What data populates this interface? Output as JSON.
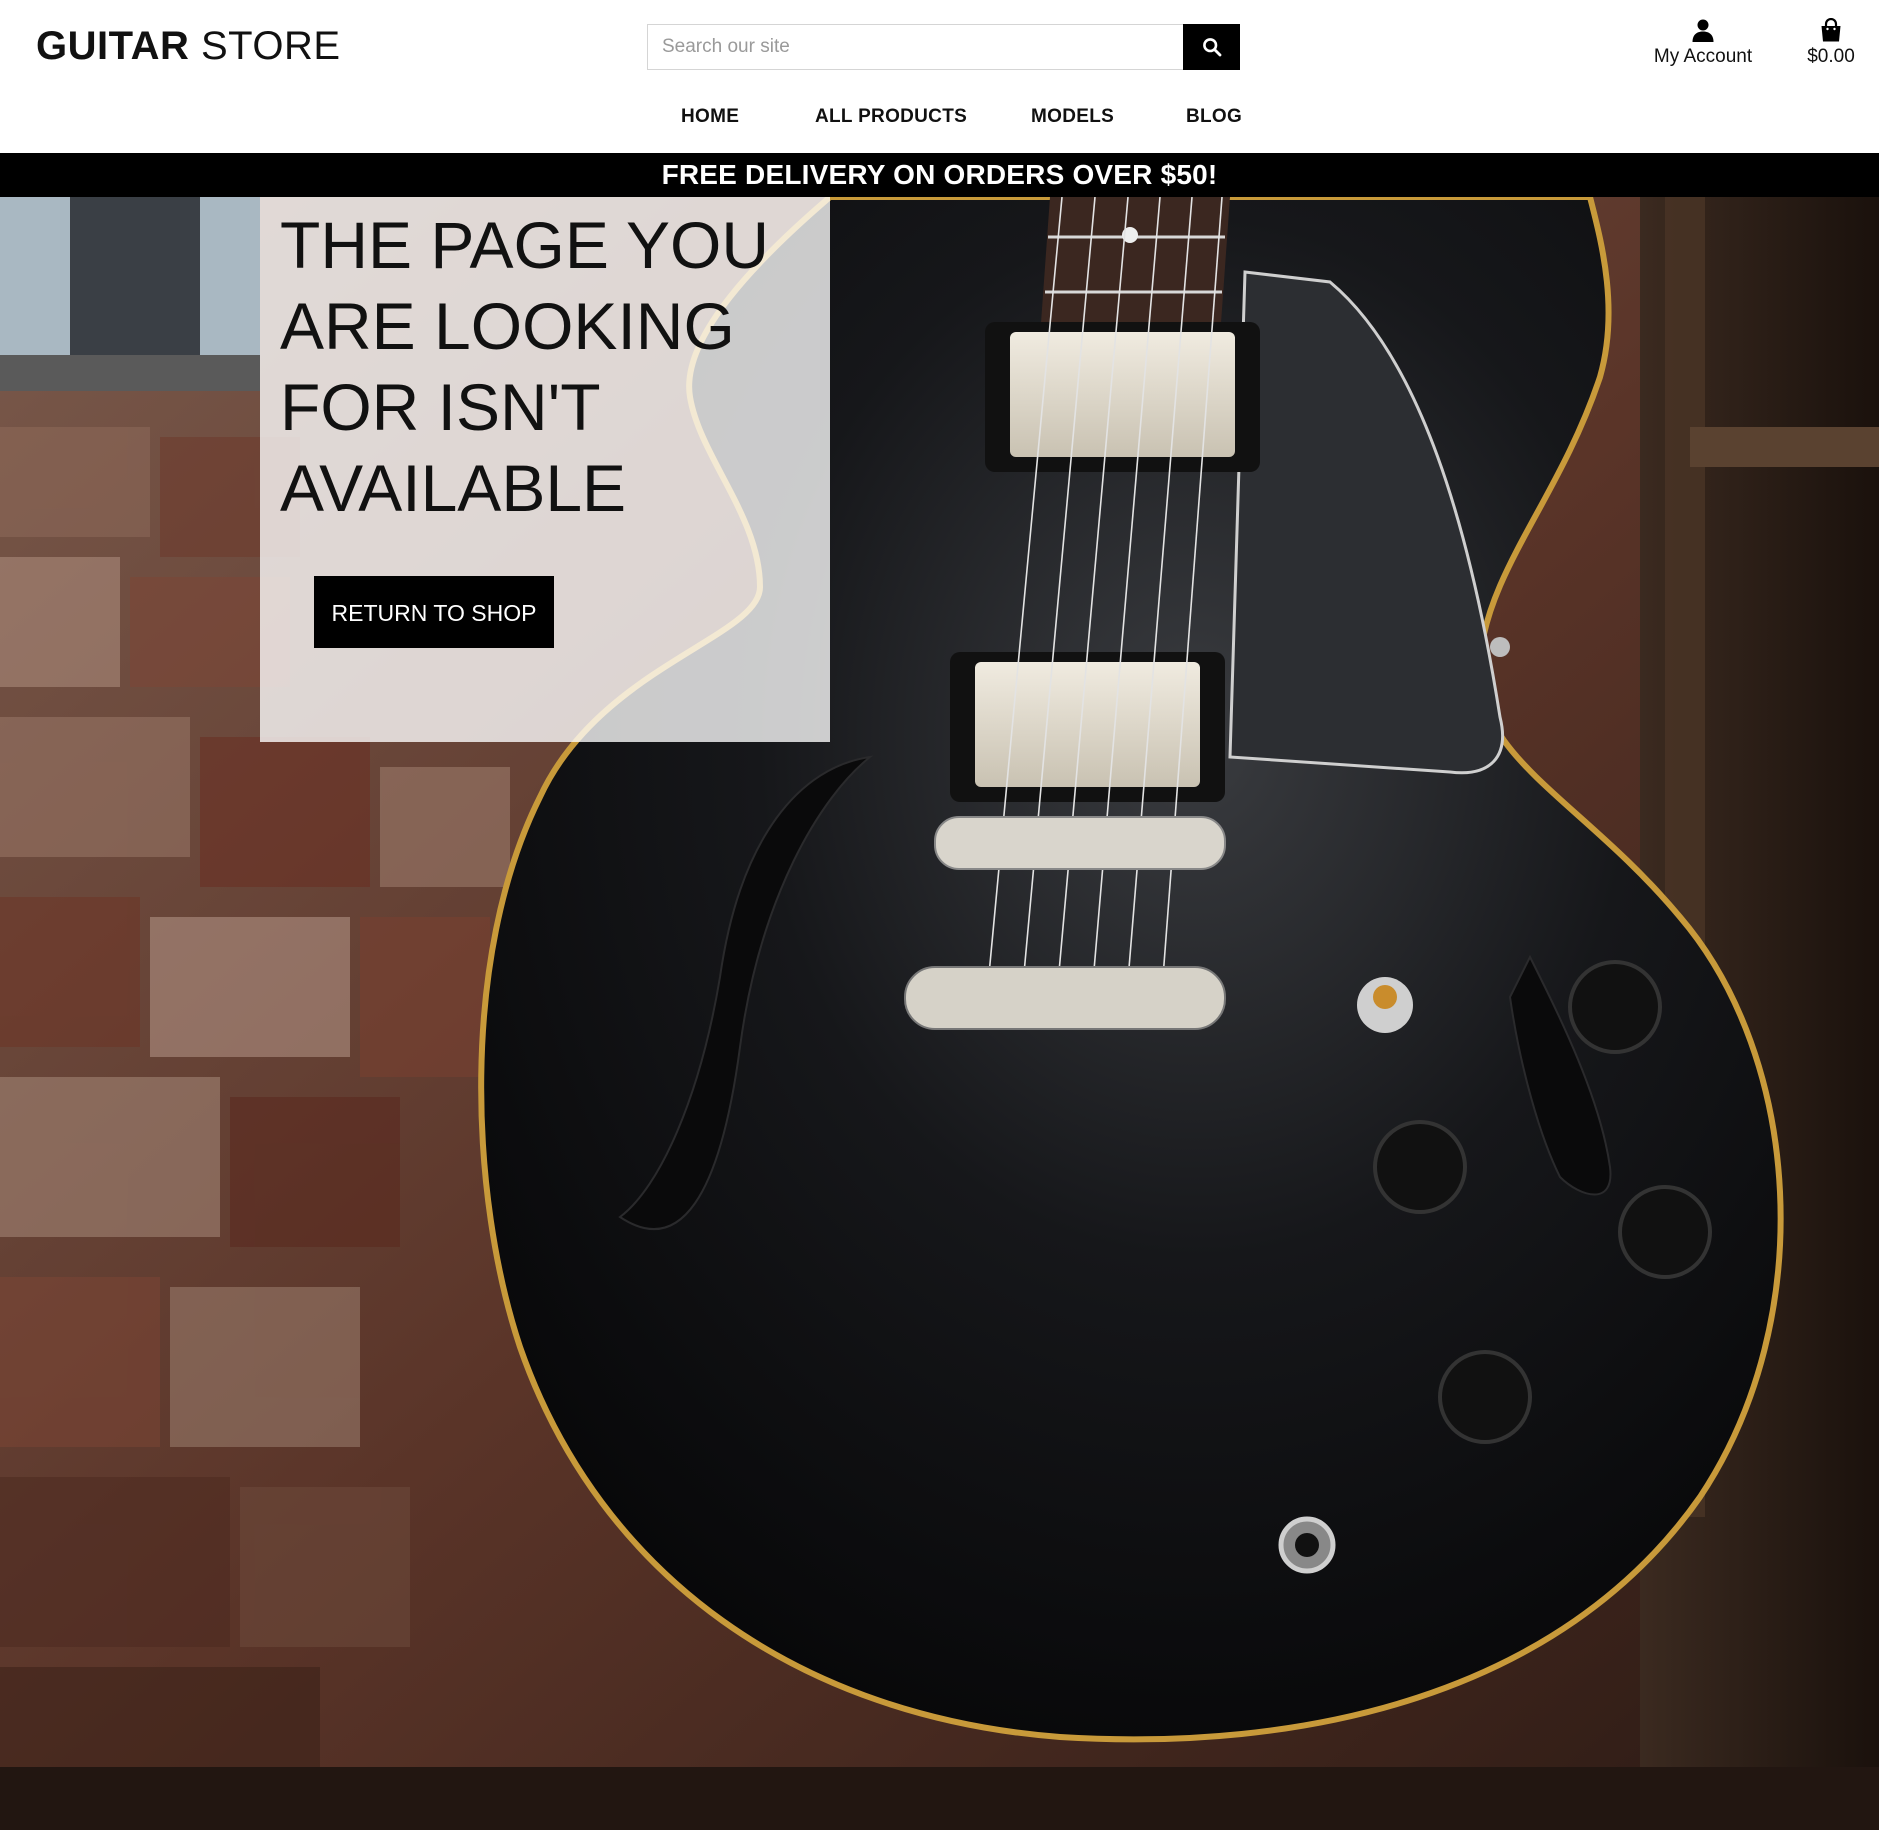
{
  "brand": {
    "name_bold": "GUITAR",
    "name_regular": "STORE"
  },
  "search": {
    "placeholder": "Search our site",
    "value": "",
    "button_icon": "search-icon"
  },
  "account": {
    "label": "My Account",
    "icon": "user-icon"
  },
  "basket": {
    "total": "$0.00",
    "icon": "shopping-bag-icon"
  },
  "nav": {
    "items": [
      {
        "label": "HOME"
      },
      {
        "label": "ALL PRODUCTS"
      },
      {
        "label": "MODELS"
      },
      {
        "label": "BLOG"
      }
    ]
  },
  "banner": {
    "text": "FREE DELIVERY ON ORDERS OVER $50!"
  },
  "error": {
    "heading": "THE PAGE YOU ARE LOOKING FOR ISN'T AVAILABLE",
    "button_label": "RETURN TO SHOP"
  },
  "colors": {
    "primary": "#000000",
    "background": "#ffffff",
    "banner_text": "#ffffff"
  }
}
